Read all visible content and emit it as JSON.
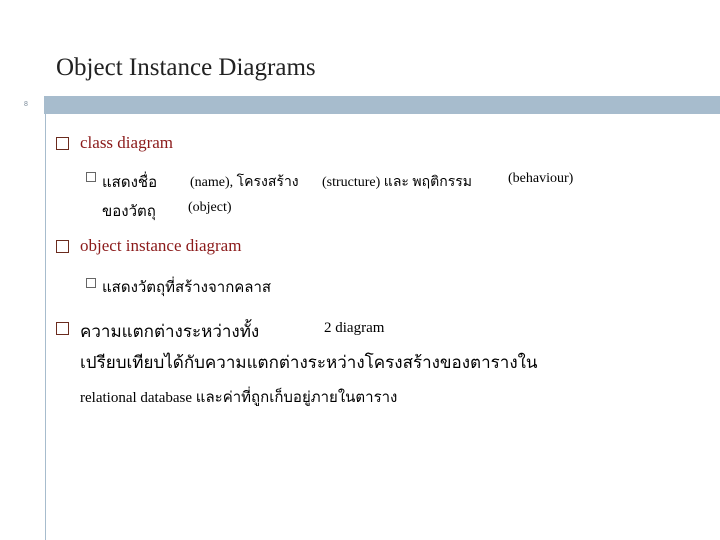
{
  "slide": {
    "title": "Object Instance Diagrams",
    "number": "8"
  },
  "bullets": {
    "b1": {
      "text": "class diagram",
      "sub": {
        "line1_a": "แสดงชื่อ",
        "line1_b": "(name), โครงสร้าง",
        "line1_c": "(structure) และ พฤติกรรม",
        "line1_d": "(behaviour)",
        "line2_a": "ของวัตถุ",
        "line2_b": "(object)"
      }
    },
    "b2": {
      "text": "object instance diagram",
      "sub": "แสดงวัตถุที่สร้างจากคลาส"
    },
    "b3": {
      "line1_a": "ความแตกต่างระหว่างทั้ง",
      "line1_b": "2 diagram",
      "line2": "เปรียบเทียบได้กับความแตกต่างระหว่างโครงสร้างของตารางใน",
      "line3": "relational database และค่าที่ถูกเก็บอยู่ภายในตาราง"
    }
  },
  "colors": {
    "header_bar": "#a7bccd",
    "bullet_red": "#8b1a1a"
  }
}
